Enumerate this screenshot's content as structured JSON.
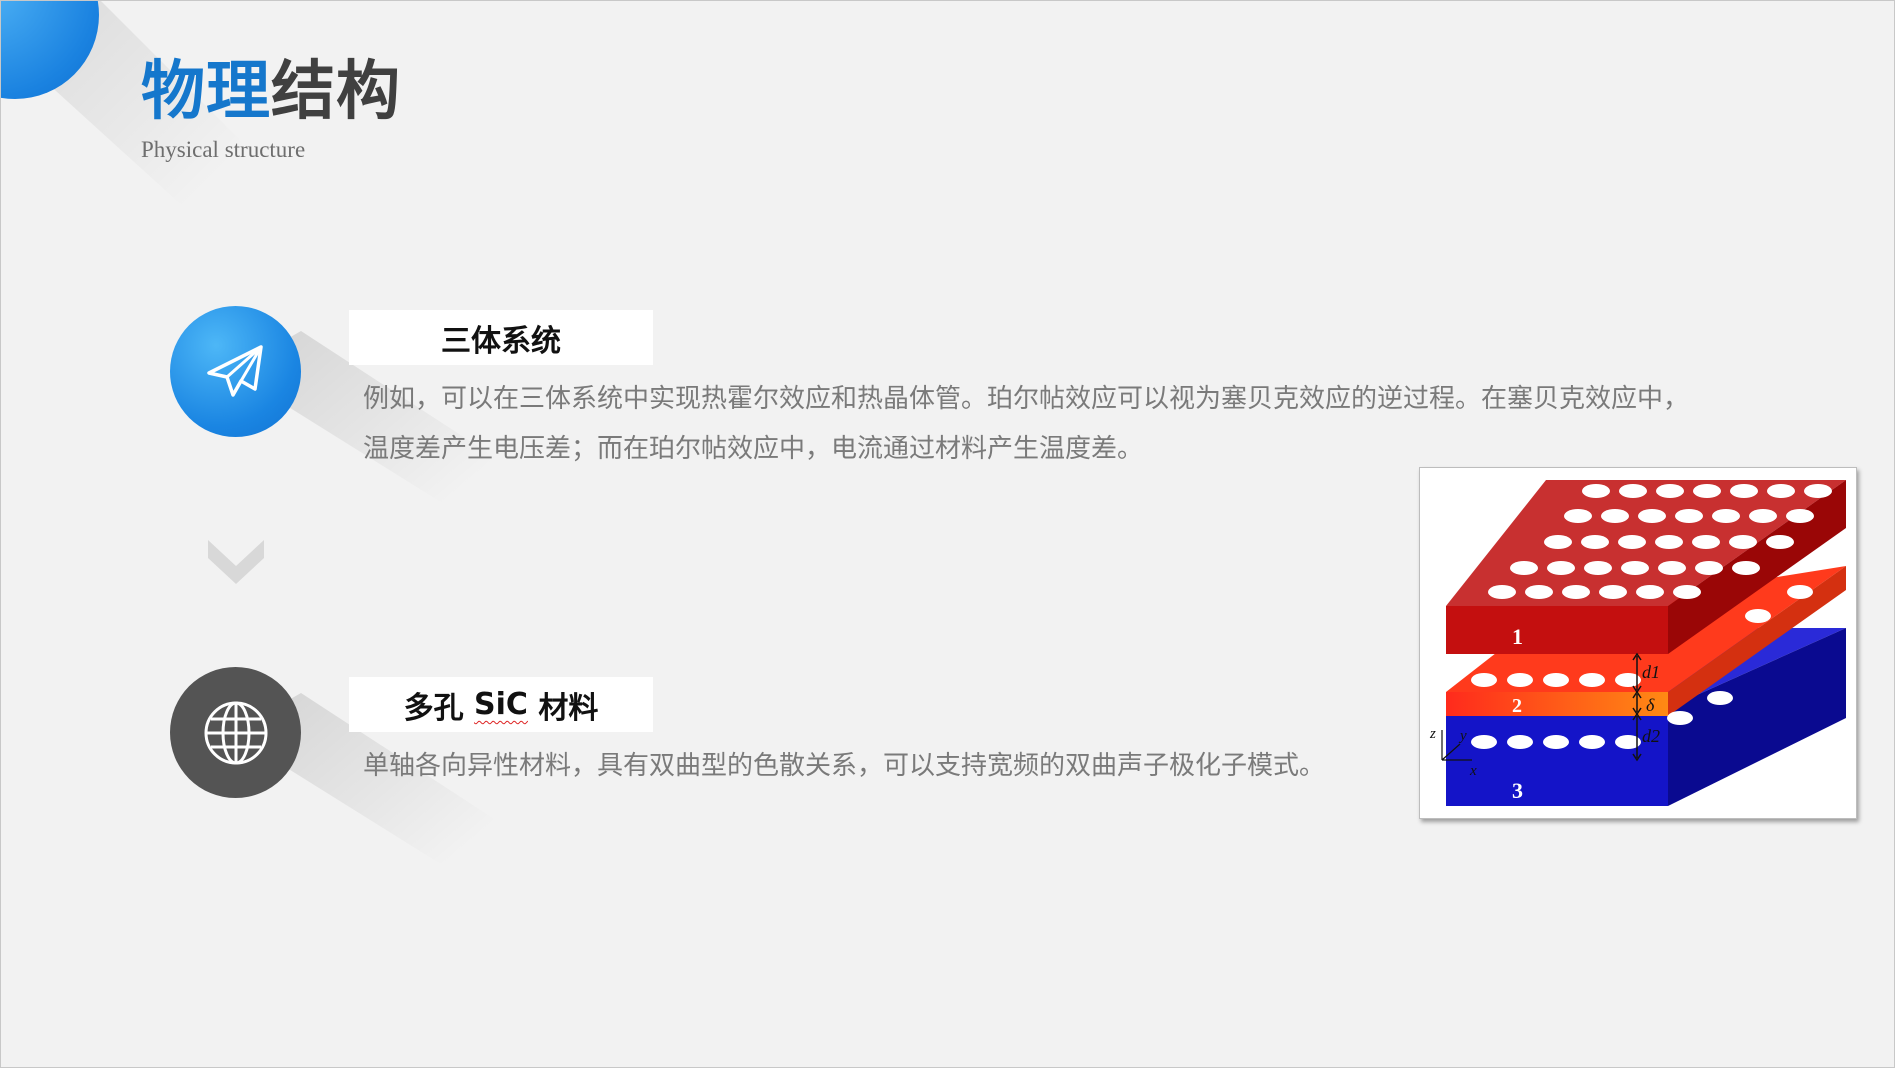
{
  "title": {
    "blue_part": "物理",
    "gray_part": "结构",
    "subtitle": "Physical structure"
  },
  "colors": {
    "accent_blue": "#1577cc",
    "icon_gray": "#545454",
    "layer1": "#c81e1e",
    "layer2": "#ff4b14",
    "layer3": "#1428d2"
  },
  "sections": [
    {
      "icon": "paper-plane-icon",
      "label": "三体系统",
      "lines": [
        "例如，可以在三体系统中实现热霍尔效应和热晶体管。珀尔帖效应可以视为塞贝克效应的逆过程。在塞贝克效应中，",
        "温度差产生电压差；而在珀尔帖效应中，电流通过材料产生温度差。"
      ]
    },
    {
      "icon": "globe-icon",
      "label_prefix": "多孔 ",
      "label_sic": "SiC",
      "label_suffix": " 材料",
      "lines": [
        "单轴各向异性材料，具有双曲型的色散关系，可以支持宽频的双曲声子极化子模式。"
      ]
    }
  ],
  "divider_icon": "chevron-down-icon",
  "figure": {
    "layer_labels": [
      "1",
      "2",
      "3"
    ],
    "dim_labels": [
      "d1",
      "δ",
      "d2"
    ],
    "axis_labels": [
      "z",
      "y",
      "x"
    ]
  }
}
